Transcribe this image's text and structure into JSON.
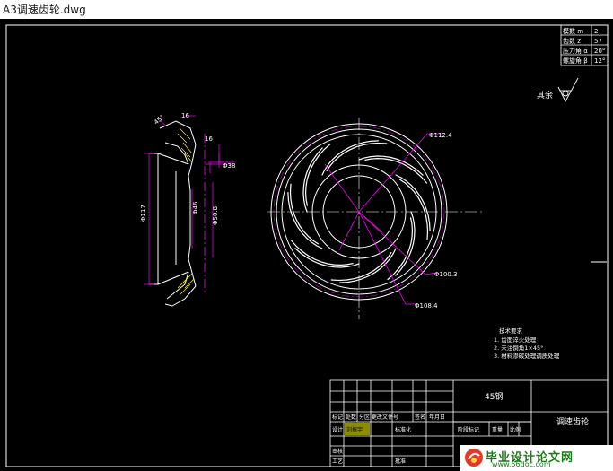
{
  "window": {
    "title": "A3调速齿轮.dwg"
  },
  "params": {
    "rows": [
      {
        "label": "模数 m",
        "value": "2"
      },
      {
        "label": "齿数 z",
        "value": "57"
      },
      {
        "label": "压力角 α",
        "value": "20°"
      },
      {
        "label": "螺旋角 β",
        "value": "12°"
      }
    ]
  },
  "roughness": {
    "label": "其余"
  },
  "dimensions": {
    "side_angle": "45°",
    "side_top": "16",
    "side_width": "16",
    "side_d1": "Φ38",
    "side_d2": "Φ46",
    "side_d3": "Φ50.8",
    "side_d4": "Φ117",
    "front_d1": "Φ112.4",
    "front_d2": "Φ100.3",
    "front_d3": "Φ108.4"
  },
  "notes": {
    "heading": "技术要求",
    "items": [
      "1. 齿面淬火处理",
      "2. 未注倒角1×45°",
      "3. 材料渗碳处理调质处理"
    ]
  },
  "title_block": {
    "material": "45钢",
    "part_name": "调速齿轮",
    "row_labels": [
      "标记",
      "处数",
      "分区",
      "更改文件号",
      "签名",
      "年月日"
    ],
    "design": "设计",
    "designer": "刘振宇",
    "standard": "标准化",
    "stage_label": "阶段标记",
    "weight_label": "重量",
    "scale_label": "比例",
    "review": "审核",
    "process": "工艺",
    "approve": "批准"
  },
  "watermark": {
    "title": "毕业设计论文网",
    "url": "www.56doc.com"
  },
  "colors": {
    "outline": "#ffffff",
    "center": "#ff00ff",
    "dim": "#ff00ff",
    "hatch": "#ffff00",
    "title": "#ffffff"
  }
}
